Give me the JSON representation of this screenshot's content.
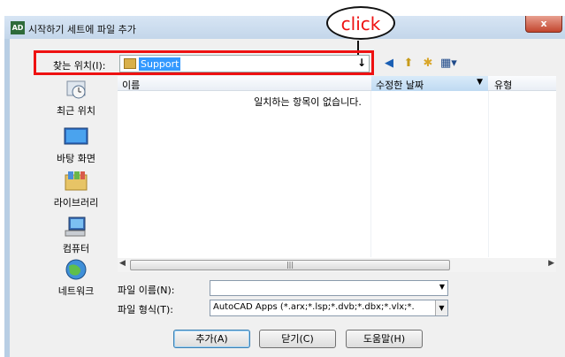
{
  "window": {
    "title": "시작하기 세트에 파일 추가",
    "app_icon": "AutoCAD",
    "close_symbol": "x"
  },
  "annotation": {
    "bubble_text": "click",
    "highlight_color": "#ee1111"
  },
  "look_in": {
    "label": "찾는 위치(I):",
    "value": "Support",
    "arrow": "↓"
  },
  "toolbar": {
    "icons": [
      "back-icon",
      "up-folder-icon",
      "new-folder-icon",
      "views-menu-icon"
    ]
  },
  "places": [
    {
      "label": "최근 위치",
      "icon": "recent-places-icon"
    },
    {
      "label": "바탕 화면",
      "icon": "desktop-icon"
    },
    {
      "label": "라이브러리",
      "icon": "libraries-icon"
    },
    {
      "label": "컴퓨터",
      "icon": "computer-icon"
    },
    {
      "label": "네트워크",
      "icon": "network-icon"
    }
  ],
  "file_list": {
    "columns": {
      "name": "이름",
      "date": "수정한 날짜",
      "type": "유형"
    },
    "empty_message": "일치하는 항목이 없습니다.",
    "scroll_thumb": "|||"
  },
  "form": {
    "filename_label": "파일 이름(N):",
    "filename_value": "",
    "filetype_label": "파일 형식(T):",
    "filetype_value": "AutoCAD Apps (*.arx;*.lsp;*.dvb;*.dbx;*.vlx;*."
  },
  "buttons": {
    "add": "추가(A)",
    "close": "닫기(C)",
    "help": "도움말(H)"
  }
}
